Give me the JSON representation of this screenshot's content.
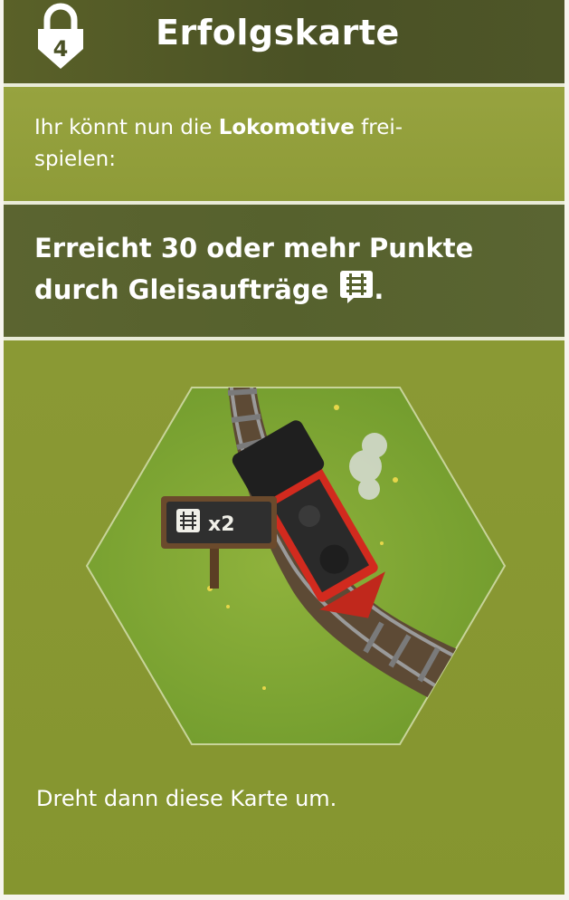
{
  "header": {
    "level": "4",
    "title": "Erfolgskarte",
    "lock_icon": "padlock-icon"
  },
  "intro": {
    "prefix": "Ihr könnt nun die ",
    "highlight": "Lokomotive",
    "suffix": " frei-",
    "line2": "spielen:"
  },
  "goal": {
    "line1": "Erreicht 30 oder mehr Punkte",
    "line2": "durch Gleisaufträge",
    "trailing": ".",
    "icon": "track-order-icon"
  },
  "tile": {
    "sign_label": "x2",
    "sign_icon": "track-order-icon",
    "illustration": "locomotive-on-track"
  },
  "footer": {
    "text": "Dreht dann diese Karte um."
  },
  "colors": {
    "header_dark": "#4a5125",
    "card_green": "#8c9a38",
    "rule": "#e9ebd7",
    "locomotive_red": "#d22a1e"
  }
}
